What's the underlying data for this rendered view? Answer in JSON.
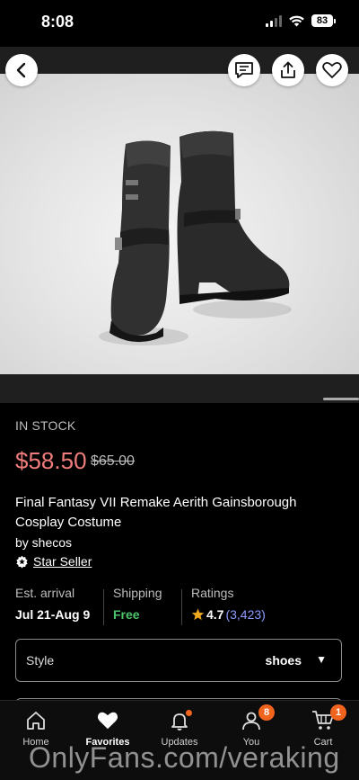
{
  "status_bar": {
    "time": "8:08",
    "battery": "83"
  },
  "product": {
    "stock": "IN STOCK",
    "price": "$58.50",
    "original_price": "$65.00",
    "title": "Final Fantasy VII Remake Aerith Gainsborough Cosplay Costume",
    "seller": "by shecos",
    "badge": "Star Seller",
    "arrival_label": "Est. arrival",
    "arrival_value": "Jul 21-Aug 9",
    "shipping_label": "Shipping",
    "shipping_value": "Free",
    "ratings_label": "Ratings",
    "rating_value": "4.7",
    "rating_count": "(3,423)"
  },
  "style_select": {
    "label": "Style",
    "value": "shoes"
  },
  "tab_bar": {
    "home": "Home",
    "favorites": "Favorites",
    "updates": "Updates",
    "you": "You",
    "you_badge": "8",
    "cart": "Cart",
    "cart_badge": "1"
  },
  "watermark": "OnlyFans.com/veraking",
  "colors": {
    "price": "#f07c7c",
    "free": "#4cc36a",
    "link": "#8c9bff",
    "badge": "#f1641e",
    "star": "#f1a81e"
  }
}
